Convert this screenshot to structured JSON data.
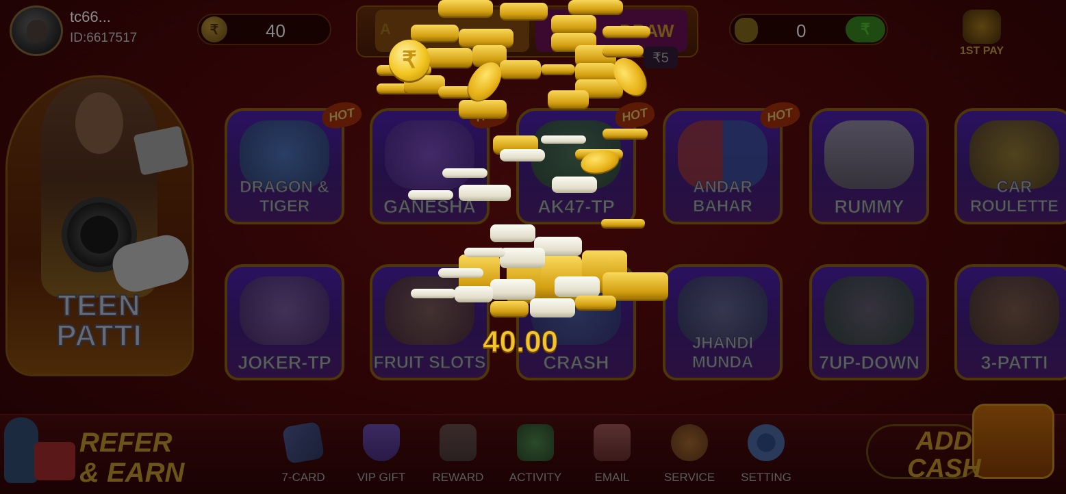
{
  "user": {
    "name": "tc66...",
    "id": "ID:6617517"
  },
  "wallet": {
    "currency_symbol": "₹",
    "balance": "40",
    "bonus_value": "0",
    "bonus_btn_symbol": "₹"
  },
  "center_tab": {
    "left_label": "A",
    "right_label": "DRAW",
    "small_value": "₹5"
  },
  "first_pay": {
    "label": "1ST PAY"
  },
  "hero": {
    "title_line1": "TEEN",
    "title_line2": "PATTI"
  },
  "games": [
    {
      "label": "DRAGON & TIGER",
      "hot": true
    },
    {
      "label": "GANESHA",
      "hot": true
    },
    {
      "label": "AK47-TP",
      "hot": true
    },
    {
      "label": "ANDAR BAHAR",
      "hot": true
    },
    {
      "label": "RUMMY",
      "hot": false
    },
    {
      "label": "CAR ROULETTE",
      "hot": false
    },
    {
      "label": "JOKER-TP",
      "hot": false
    },
    {
      "label": "FRUIT SLOTS",
      "hot": false
    },
    {
      "label": "CRASH",
      "hot": false
    },
    {
      "label": "JHANDI MUNDA",
      "hot": false
    },
    {
      "label": "7UP-DOWN",
      "hot": false
    },
    {
      "label": "3-PATTI",
      "hot": false
    }
  ],
  "hot_badge": "HOT",
  "reward_popup": {
    "amount": "40.00",
    "coin_symbol": "₹"
  },
  "bottom": {
    "refer_line1": "REFER",
    "refer_line2": "& EARN",
    "nav": [
      "7-CARD",
      "VIP GIFT",
      "REWARD",
      "ACTIVITY",
      "EMAIL",
      "SERVICE",
      "SETTING"
    ],
    "add_cash_line1": "ADD",
    "add_cash_line2": "CASH"
  },
  "colors": {
    "coin_gold": "#f2c520",
    "amount_text": "#f5c230",
    "overlay_bg": "#2a0405"
  }
}
